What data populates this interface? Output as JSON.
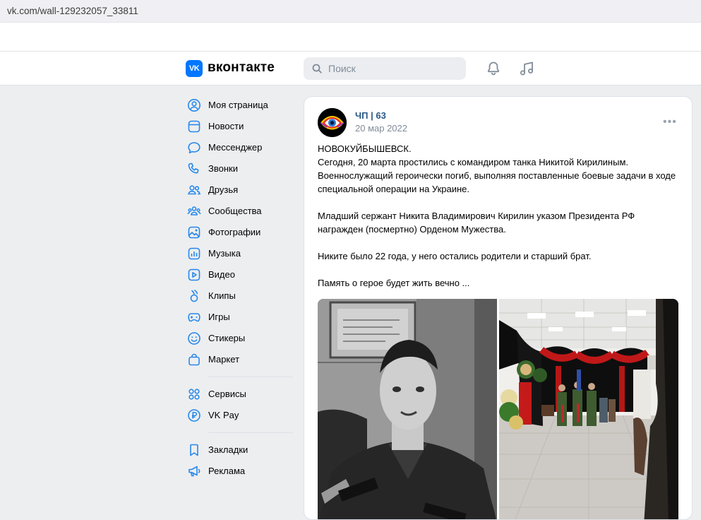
{
  "browser": {
    "url": "vk.com/wall-129232057_33811"
  },
  "header": {
    "logo_mark": "VK",
    "logo_text": "вконтакте",
    "search_placeholder": "Поиск",
    "icons": [
      "bell-icon",
      "music-icon"
    ]
  },
  "sidebar": {
    "items": [
      {
        "label": "Моя страница",
        "icon": "user-circle-icon"
      },
      {
        "label": "Новости",
        "icon": "newspaper-icon"
      },
      {
        "label": "Мессенджер",
        "icon": "message-bubble-icon"
      },
      {
        "label": "Звонки",
        "icon": "phone-icon"
      },
      {
        "label": "Друзья",
        "icon": "friends-icon"
      },
      {
        "label": "Сообщества",
        "icon": "communities-icon"
      },
      {
        "label": "Фотографии",
        "icon": "photo-icon"
      },
      {
        "label": "Музыка",
        "icon": "music-bars-icon"
      },
      {
        "label": "Видео",
        "icon": "video-icon"
      },
      {
        "label": "Клипы",
        "icon": "clips-icon"
      },
      {
        "label": "Игры",
        "icon": "gamepad-icon"
      },
      {
        "label": "Стикеры",
        "icon": "smile-icon"
      },
      {
        "label": "Маркет",
        "icon": "bag-icon"
      }
    ],
    "group2": [
      {
        "label": "Сервисы",
        "icon": "services-icon"
      },
      {
        "label": "VK Pay",
        "icon": "ruble-icon"
      }
    ],
    "group3": [
      {
        "label": "Закладки",
        "icon": "bookmark-icon"
      },
      {
        "label": "Реклама",
        "icon": "megaphone-icon"
      }
    ]
  },
  "post": {
    "author": "ЧП | 63",
    "date": "20 мар 2022",
    "paragraphs": [
      "НОВОКУЙБЫШЕВСК.\nСегодня, 20 марта простились с командиром танка Никитой Кирилиным. Военнослужащий героически погиб, выполняя поставленные боевые задачи в ходе специальной операции на Украине.",
      "Младший сержант Никита Владимирович Кирилин указом Президента РФ награжден (посмертно) Орденом Мужества.",
      "Никите было 22 года, у него остались родители и старший брат.",
      "Память о герое будет жить вечно ..."
    ],
    "photos": [
      "portrait-photo",
      "ceremony-hall-photo"
    ]
  },
  "colors": {
    "accent": "#0077ff",
    "link": "#2a5885",
    "muted": "#818c99",
    "icon": "#2688eb",
    "bg": "#edeef0"
  }
}
